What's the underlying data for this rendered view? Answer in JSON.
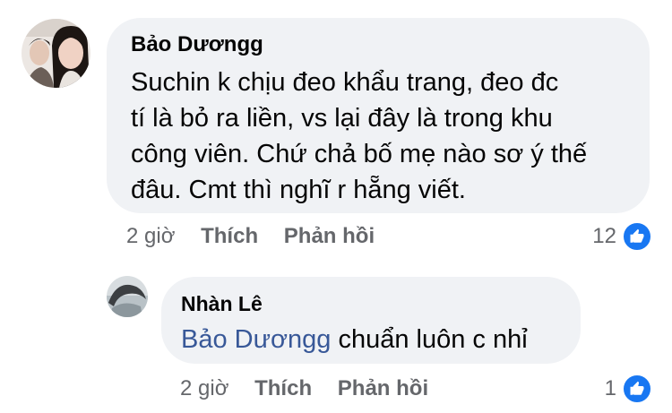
{
  "comments": [
    {
      "author": "Bảo Dươngg",
      "lines": [
        "Suchin k chịu đeo khẩu trang, đeo đc",
        "tí là bỏ ra liền, vs lại đây là trong khu",
        "công viên. Chứ chả bố mẹ nào sơ ý thế",
        "đâu. Cmt thì nghĩ r hẵng viết."
      ],
      "time": "2 giờ",
      "like_label": "Thích",
      "reply_label": "Phản hồi",
      "reaction_count": "12",
      "reaction_icon": "thumbs-up-icon"
    },
    {
      "author": "Nhàn Lê",
      "mention": "Bảo Dươngg",
      "text": " chuẩn luôn c nhỉ",
      "time": "2 giờ",
      "like_label": "Thích",
      "reply_label": "Phản hồi",
      "reaction_count": "1",
      "reaction_icon": "thumbs-up-icon"
    }
  ],
  "colors": {
    "bubble": "#f0f2f5",
    "meta": "#65676b",
    "mention": "#385898",
    "like": "#1877f2"
  }
}
